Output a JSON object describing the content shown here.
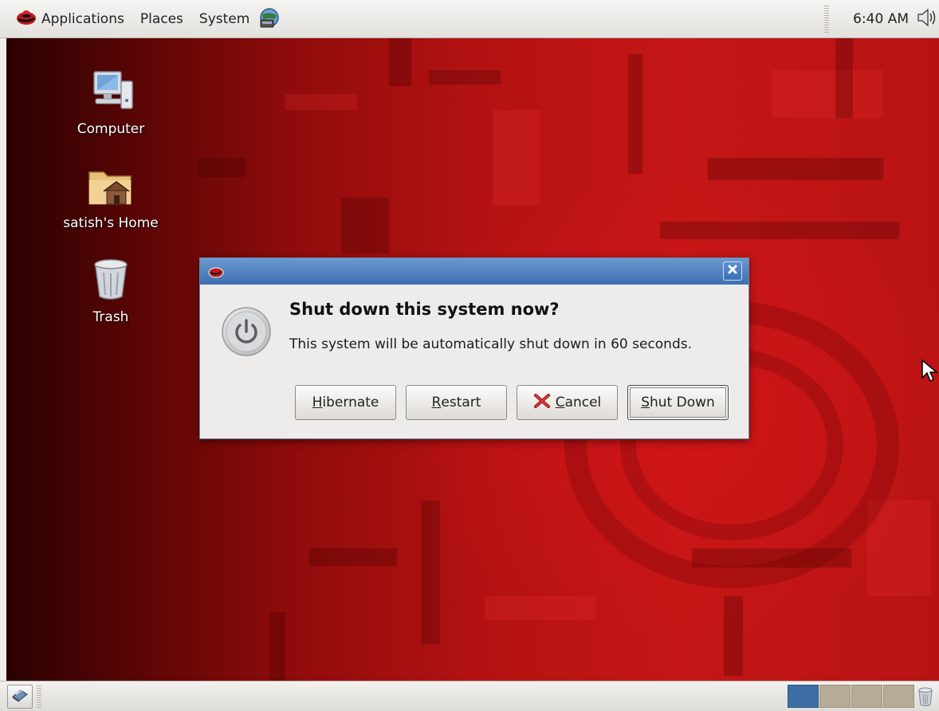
{
  "top_panel": {
    "menus": [
      {
        "label": "Applications",
        "icon": "redhat-logo-icon"
      },
      {
        "label": "Places"
      },
      {
        "label": "System"
      }
    ],
    "network_icon": "network-globe-icon",
    "clock": "6:40 AM",
    "volume_icon": "speaker-volume-icon"
  },
  "desktop": {
    "icons": [
      {
        "label": "Computer",
        "icon": "computer-icon"
      },
      {
        "label": "satish's Home",
        "icon": "home-folder-icon"
      },
      {
        "label": "Trash",
        "icon": "trash-icon"
      }
    ],
    "background_colors": {
      "dark": "#2b0101",
      "bright": "#c41616"
    }
  },
  "dialog": {
    "title": "Shut down this system now?",
    "message": "This system will be automatically shut down in 60 seconds.",
    "icon": "power-icon",
    "buttons": {
      "hibernate": {
        "label": "Hibernate",
        "mnemonic": "H",
        "rest": "ibernate"
      },
      "restart": {
        "label": "Restart",
        "mnemonic": "R",
        "rest": "estart"
      },
      "cancel": {
        "label": "Cancel",
        "mnemonic": "C",
        "rest": "ancel"
      },
      "shutdown": {
        "label": "Shut Down",
        "mnemonic": "S",
        "rest": "hut Down"
      }
    },
    "default_button": "Shut Down",
    "titlebar_color": "#3c6eb1"
  },
  "bottom_panel": {
    "workspaces": 4,
    "active_workspace": 1,
    "show_desktop_icon": "show-desktop-icon",
    "trash_icon": "trash-applet-icon"
  }
}
